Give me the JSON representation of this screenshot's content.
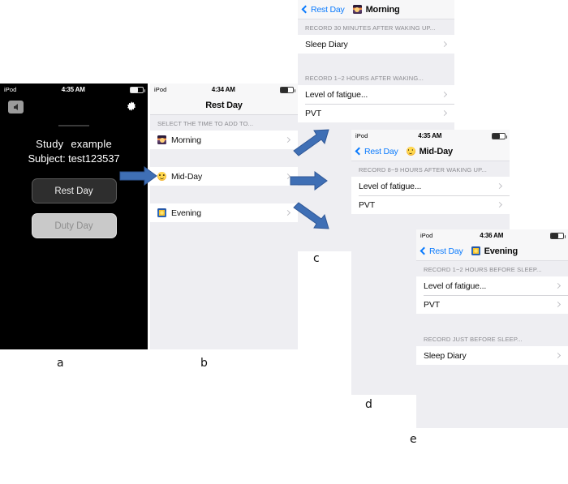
{
  "figure": {
    "letters": [
      {
        "id": "a",
        "text": "a"
      },
      {
        "id": "b",
        "text": "b"
      },
      {
        "id": "c",
        "text": "c"
      },
      {
        "id": "d",
        "text": "d"
      },
      {
        "id": "e",
        "text": "e"
      }
    ]
  },
  "panel_a": {
    "status": {
      "carrier": "iPod",
      "time": "4:35 AM",
      "battery_icon": "battery-icon"
    },
    "back_icon": "back-arrow-icon",
    "settings_icon": "gear-icon",
    "study_label": "Study",
    "study_value": "example",
    "subject_line": "Subject: test123537",
    "buttons": [
      {
        "label": "Rest Day",
        "style": "dark"
      },
      {
        "label": "Duty Day",
        "style": "light"
      }
    ]
  },
  "panel_b": {
    "status": {
      "carrier": "iPod",
      "time": "4:34 AM",
      "battery_icon": "battery-icon"
    },
    "title": "Rest Day",
    "section_header": "SELECT THE TIME TO ADD TO...",
    "rows": [
      {
        "icon": "sunrise-icon",
        "label": "Morning"
      },
      {
        "icon": "sun-face-icon",
        "label": "Mid-Day"
      },
      {
        "icon": "evening-icon",
        "label": "Evening"
      }
    ]
  },
  "panel_c": {
    "back_label": "Rest Day",
    "title": "Morning",
    "title_icon": "sunrise-icon",
    "sections": [
      {
        "header": "RECORD 30 MINUTES AFTER WAKING UP...",
        "rows": [
          {
            "label": "Sleep Diary"
          }
        ]
      },
      {
        "header": "RECORD 1~2 HOURS AFTER WAKING...",
        "rows": [
          {
            "label": "Level of fatigue..."
          },
          {
            "label": "PVT"
          }
        ]
      }
    ]
  },
  "panel_d": {
    "status": {
      "carrier": "iPod",
      "time": "4:35 AM",
      "battery_icon": "battery-icon"
    },
    "back_label": "Rest Day",
    "title": "Mid-Day",
    "title_icon": "sun-face-icon",
    "sections": [
      {
        "header": "RECORD 8~9 HOURS AFTER WAKING UP...",
        "rows": [
          {
            "label": "Level of fatigue..."
          },
          {
            "label": "PVT"
          }
        ]
      }
    ]
  },
  "panel_e": {
    "status": {
      "carrier": "iPod",
      "time": "4:36 AM",
      "battery_icon": "battery-icon"
    },
    "back_label": "Rest Day",
    "title": "Evening",
    "title_icon": "evening-icon",
    "sections": [
      {
        "header": "RECORD 1~2 HOURS BEFORE SLEEP...",
        "rows": [
          {
            "label": "Level of fatigue..."
          },
          {
            "label": "PVT"
          }
        ]
      },
      {
        "header": "RECORD JUST BEFORE SLEEP...",
        "rows": [
          {
            "label": "Sleep Diary"
          }
        ]
      }
    ]
  },
  "colors": {
    "arrow_blue": "#3f6fb5",
    "link_blue": "#0b7bfd",
    "panel_bg": "#eeeef2",
    "row_bg": "#ffffff",
    "header_text": "#8a8a8f"
  }
}
